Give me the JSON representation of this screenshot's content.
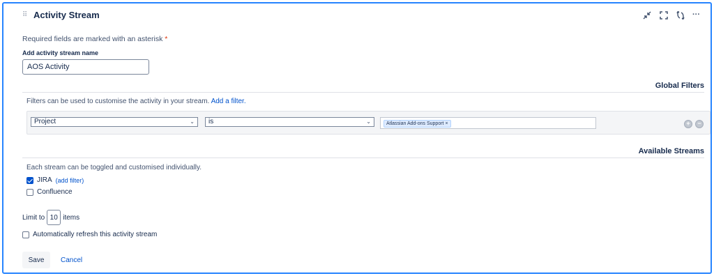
{
  "gadget": {
    "title": "Activity Stream",
    "header_icons": [
      "collapse-icon",
      "maximize-icon",
      "refresh-icon",
      "more-icon"
    ],
    "more_label": "···"
  },
  "form": {
    "required_note": "Required fields are marked with an asterisk",
    "asterisk": "*",
    "name_label": "Add activity stream name",
    "name_value": "AOS Activity"
  },
  "global_filters": {
    "title": "Global Filters",
    "help_text": "Filters can be used to customise the activity in your stream.",
    "add_filter_link": "Add a filter.",
    "filter": {
      "field": "Project",
      "operator": "is",
      "values": [
        {
          "label": "Atlassian Add-ons Support",
          "remove": "×"
        }
      ]
    },
    "add_button": "+",
    "remove_button": "−"
  },
  "streams": {
    "title": "Available Streams",
    "help_text": "Each stream can be toggled and customised individually.",
    "items": [
      {
        "label": "JIRA",
        "checked": true,
        "link": "(add filter)"
      },
      {
        "label": "Confluence",
        "checked": false,
        "link": ""
      }
    ]
  },
  "limit": {
    "prefix": "Limit to",
    "value": "10",
    "suffix": "items"
  },
  "auto_refresh": {
    "label": "Automatically refresh this activity stream",
    "checked": false
  },
  "actions": {
    "save": "Save",
    "cancel": "Cancel"
  },
  "colors": {
    "accent": "#2684ff",
    "link": "#0052cc",
    "required": "#de350b"
  }
}
